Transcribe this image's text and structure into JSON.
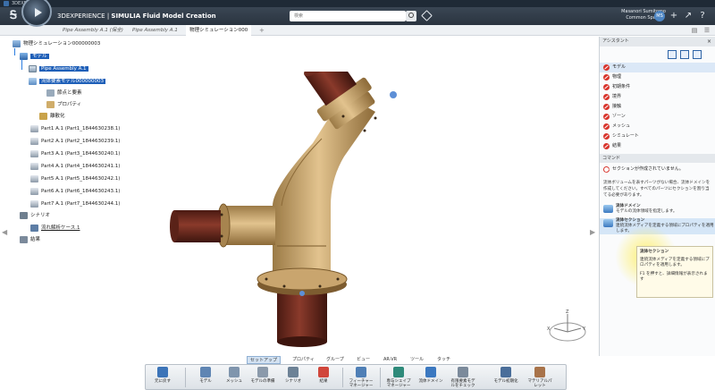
{
  "os": {
    "title": "3DEXPERIENCE"
  },
  "topbar": {
    "brand": "3DEXPERIENCE | ",
    "app": "SIMULIA Fluid Model Creation",
    "search_placeholder": "検索",
    "user_name": "Masanori Sumitomo",
    "user_space": "Common Space",
    "avatar_initials": "MS"
  },
  "tabs": [
    {
      "label": "Pipe Assembly A.1 (保全)"
    },
    {
      "label": "Pipe Assembly A.1"
    },
    {
      "label": "物理シミュレーション000"
    }
  ],
  "tree": {
    "root": "物理シミュレーション000000003",
    "model": "モデル",
    "assembly": "Pipe Assembly A.1",
    "flow_model": "流体要素モデル000000003",
    "points": "節点と要素",
    "property": "プロパティ",
    "mesh": "離散化",
    "parts": [
      "Part1 A.1 (Part1_1844630238.1)",
      "Part2 A.1 (Part2_1844630239.1)",
      "Part3 A.1 (Part3_1844630240.1)",
      "Part4 A.1 (Part4_1844630241.1)",
      "Part5 A.1 (Part5_1844630242.1)",
      "Part6 A.1 (Part6_1844630243.1)",
      "Part7 A.1 (Part7_1844630244.1)"
    ],
    "scenario": "シナリオ",
    "case": "流れ解析ケース.1",
    "results": "結果"
  },
  "assistant": {
    "title": "アシスタント",
    "steps": [
      "モデル",
      "物理",
      "初期条件",
      "境界",
      "接触",
      "ゾーン",
      "メッシュ",
      "シミュレート",
      "結果"
    ],
    "commands_header": "コマンド",
    "warning": "セクションが作成されていません。",
    "note": "流体ボリュームを表すパーツがない場合、流体ドメインを作成してください。すべてのパーツにセクションを割り当てる必要があります。",
    "cmd1_title": "流体ドメイン",
    "cmd1_desc": "モデルの流体領域を指定します。",
    "cmd2_title": "流体セクション",
    "cmd2_desc": "連続流体メディアを定義する領域にプロパティを適用します。"
  },
  "tooltip": {
    "title": "流体セクション",
    "desc": "連続流体メディアを定義する領域にプロパティを適用します。",
    "hint": "F1 を押すと、詳細情報が表示されます"
  },
  "action_tabs": [
    "セットアップ",
    "プロパティ",
    "グループ",
    "ビュー",
    "AR-VR",
    "ツール",
    "タッチ"
  ],
  "actions": [
    {
      "label": "元に戻す",
      "color": "#3c74b8"
    },
    {
      "label": "モデル",
      "color": "#5f85b3"
    },
    {
      "label": "メッシュ",
      "color": "#7f95ad"
    },
    {
      "label": "モデルの準備",
      "color": "#8b9aab"
    },
    {
      "label": "シナリオ",
      "color": "#6d8296"
    },
    {
      "label": "結果",
      "color": "#d0463b"
    },
    {
      "label": "フィーチャーマネージャー",
      "color": "#4f7fb6"
    },
    {
      "label": "専与シェイプマネージャー",
      "color": "#2e8a7a"
    },
    {
      "label": "流体ドメイン",
      "color": "#3b78c0"
    },
    {
      "label": "有限要素モデルをチェック",
      "color": "#7b8a9b"
    },
    {
      "label": "モデル初期化",
      "color": "#4a6e9a"
    },
    {
      "label": "マテリアルパレット",
      "color": "#a8734a"
    }
  ],
  "triad": {
    "x": "X",
    "y": "Y",
    "z": "Z"
  },
  "colors": {
    "pipe_tan": "#c9a56e",
    "pipe_red": "#7a2f22",
    "accent": "#1e5fb8"
  }
}
